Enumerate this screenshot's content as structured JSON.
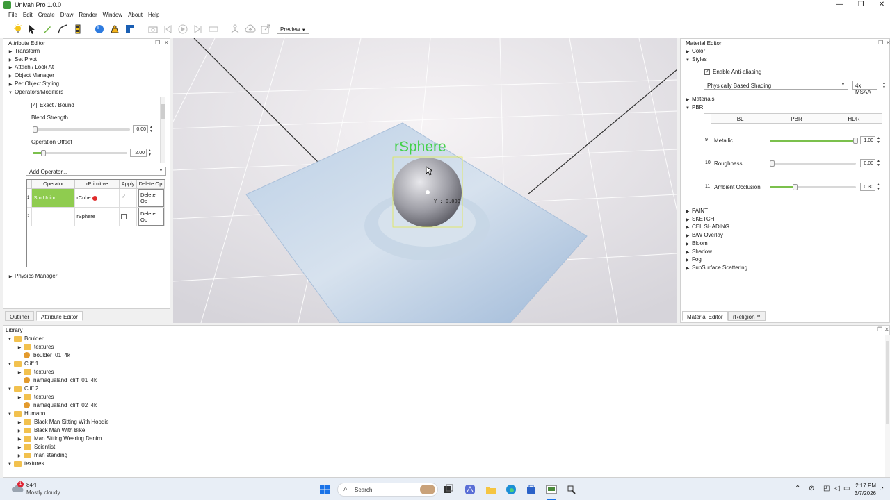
{
  "window": {
    "title": "Univah Pro 1.0.0"
  },
  "menu": [
    "File",
    "Edit",
    "Create",
    "Draw",
    "Render",
    "Window",
    "About",
    "Help"
  ],
  "toolbar": {
    "preview_label": "Preview"
  },
  "attribute_editor": {
    "title": "Attribute Editor",
    "sections": [
      "Transform",
      "Set Pivot",
      "Attach / Look At",
      "Object Manager",
      "Per Object Styling",
      "Operators/Modifiers"
    ],
    "exact_bound_label": "Exact / Bound",
    "blend_strength_label": "Blend Strength",
    "blend_strength_value": "0.00",
    "blend_strength_level": 0,
    "operation_offset_label": "Operation Offset",
    "operation_offset_value": "2.00",
    "operation_offset_level": 0.12,
    "add_operator_label": "Add Operator...",
    "table": {
      "headers": [
        "Operator",
        "rPrimitive",
        "Apply",
        "Delete Op"
      ],
      "rows": [
        {
          "num": "1",
          "operator": "Sm Union",
          "primitive": "rCube",
          "applied": true,
          "delete": "Delete Op"
        },
        {
          "num": "2",
          "operator": "",
          "primitive": "rSphere",
          "applied": false,
          "delete": "Delete Op"
        }
      ]
    },
    "physics_manager": "Physics Manager",
    "tabs": [
      "Outliner",
      "Attribute Editor"
    ]
  },
  "viewport": {
    "object_label": "rSphere",
    "axis_readout": "Y : 0.000"
  },
  "material_editor": {
    "title": "Material Editor",
    "color": "Color",
    "styles": "Styles",
    "enable_aa_label": "Enable Anti-aliasing",
    "shading_select": "Physically Based Shading",
    "msaa_select": "4x MSAA",
    "materials": "Materials",
    "pbr": "PBR",
    "pbr_tabs": [
      "IBL",
      "PBR",
      "HDR"
    ],
    "pbr_rows": [
      {
        "num": "9",
        "label": "Metallic",
        "value": "1.00",
        "level": 1.0
      },
      {
        "num": "10",
        "label": "Roughness",
        "value": "0.00",
        "level": 0.0
      },
      {
        "num": "11",
        "label": "Ambient Occlusion",
        "value": "0.30",
        "level": 0.3
      }
    ],
    "more_sections": [
      "PAINT",
      "SKETCH",
      "CEL SHADING",
      "B/W Overlay",
      "Bloom",
      "Shadow",
      "Fog",
      "SubSurface Scattering"
    ],
    "tabs": [
      "Material Editor",
      "rReligion™"
    ]
  },
  "library": {
    "title": "Library",
    "items": [
      {
        "depth": 0,
        "type": "folder",
        "label": "Boulder",
        "open": true
      },
      {
        "depth": 1,
        "type": "folder",
        "label": "textures",
        "open": false
      },
      {
        "depth": 1,
        "type": "asset",
        "label": "boulder_01_4k"
      },
      {
        "depth": 0,
        "type": "folder",
        "label": "Cliff 1",
        "open": true
      },
      {
        "depth": 1,
        "type": "folder",
        "label": "textures",
        "open": false
      },
      {
        "depth": 1,
        "type": "asset",
        "label": "namaqualand_cliff_01_4k"
      },
      {
        "depth": 0,
        "type": "folder",
        "label": "Cliff 2",
        "open": true
      },
      {
        "depth": 1,
        "type": "folder",
        "label": "textures",
        "open": false
      },
      {
        "depth": 1,
        "type": "asset",
        "label": "namaqualand_cliff_02_4k"
      },
      {
        "depth": 0,
        "type": "folder",
        "label": "Humano",
        "open": true
      },
      {
        "depth": 1,
        "type": "folder",
        "label": "Black Man Sitting With Hoodie",
        "open": false
      },
      {
        "depth": 1,
        "type": "folder",
        "label": "Black Man With Bike",
        "open": false
      },
      {
        "depth": 1,
        "type": "folder",
        "label": "Man Sitting Wearing Denim",
        "open": false
      },
      {
        "depth": 1,
        "type": "folder",
        "label": "Scientist",
        "open": false
      },
      {
        "depth": 1,
        "type": "folder",
        "label": "man standing",
        "open": false
      },
      {
        "depth": 0,
        "type": "folder",
        "label": "textures",
        "open": true
      }
    ]
  },
  "taskbar": {
    "weather_temp": "84°F",
    "weather_desc": "Mostly cloudy",
    "weather_badge": "1",
    "search_placeholder": "Search",
    "time": "2:17 PM",
    "date": "3/7/2026"
  },
  "colors": {
    "accent_green": "#7bc04c",
    "operator_cell": "#8fcc4f",
    "viewport_label": "#44d14a"
  }
}
